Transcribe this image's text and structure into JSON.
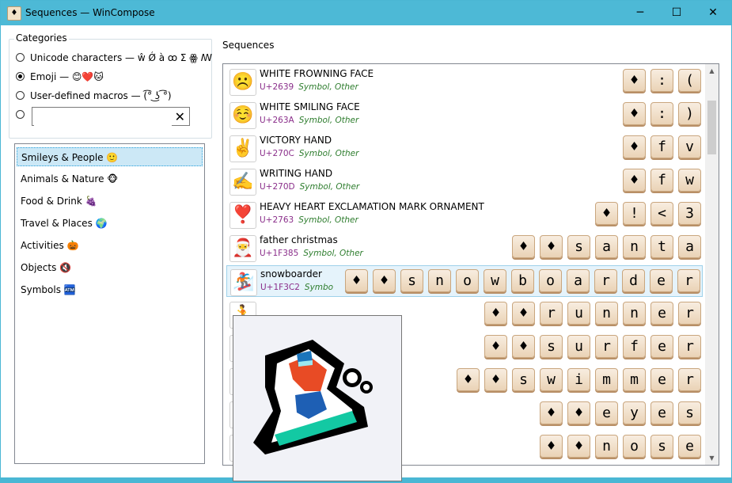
{
  "window": {
    "title": "Sequences — WinCompose",
    "app_icon": "♦",
    "minimize": "─",
    "maximize": "☐",
    "close": "✕"
  },
  "categories": {
    "legend": "Categories",
    "options": [
      {
        "label": "Unicode characters — ŵ Ǿ à ꝏ Σ ꙮ ꟿ",
        "selected": false
      },
      {
        "label": "Emoji — 😊❤️🐱",
        "selected": true
      },
      {
        "label": "User-defined macros — (͡° ͜ʖ ͡°)",
        "selected": false
      }
    ],
    "custom_value": "",
    "clear_label": "✕"
  },
  "emoji_categories": [
    {
      "label": "Smileys & People",
      "icon": "🙂",
      "selected": true
    },
    {
      "label": "Animals & Nature",
      "icon": "🐵",
      "selected": false
    },
    {
      "label": "Food & Drink",
      "icon": "🍇",
      "selected": false
    },
    {
      "label": "Travel & Places",
      "icon": "🌍",
      "selected": false
    },
    {
      "label": "Activities",
      "icon": "🎃",
      "selected": false
    },
    {
      "label": "Objects",
      "icon": "🔇",
      "selected": false
    },
    {
      "label": "Symbols",
      "icon": "🏧",
      "selected": false
    }
  ],
  "sequences": {
    "label": "Sequences",
    "rows": [
      {
        "glyph": "☹️",
        "name": "WHITE FROWNING FACE",
        "code": "U+2639",
        "category": "Symbol, Other",
        "keys": [
          "♦",
          ":",
          "("
        ]
      },
      {
        "glyph": "☺️",
        "name": "WHITE SMILING FACE",
        "code": "U+263A",
        "category": "Symbol, Other",
        "keys": [
          "♦",
          ":",
          ")"
        ]
      },
      {
        "glyph": "✌️",
        "name": "VICTORY HAND",
        "code": "U+270C",
        "category": "Symbol, Other",
        "keys": [
          "♦",
          "f",
          "v"
        ]
      },
      {
        "glyph": "✍️",
        "name": "WRITING HAND",
        "code": "U+270D",
        "category": "Symbol, Other",
        "keys": [
          "♦",
          "f",
          "w"
        ]
      },
      {
        "glyph": "❣️",
        "name": "HEAVY HEART EXCLAMATION MARK ORNAMENT",
        "code": "U+2763",
        "category": "Symbol, Other",
        "keys": [
          "♦",
          "!",
          "<",
          "3"
        ]
      },
      {
        "glyph": "🎅",
        "name": "father christmas",
        "code": "U+1F385",
        "category": "Symbol, Other",
        "keys": [
          "♦",
          "♦",
          "s",
          "a",
          "n",
          "t",
          "a"
        ]
      },
      {
        "glyph": "🏂",
        "name": "snowboarder",
        "code": "U+1F3C2",
        "category": "Symbo",
        "keys": [
          "♦",
          "♦",
          "s",
          "n",
          "o",
          "w",
          "b",
          "o",
          "a",
          "r",
          "d",
          "e",
          "r"
        ],
        "selected": true
      },
      {
        "glyph": "🏃",
        "name": "",
        "code": "",
        "category": "",
        "keys": [
          "♦",
          "♦",
          "r",
          "u",
          "n",
          "n",
          "e",
          "r"
        ]
      },
      {
        "glyph": "🏄",
        "name": "",
        "code": "",
        "category": "",
        "keys": [
          "♦",
          "♦",
          "s",
          "u",
          "r",
          "f",
          "e",
          "r"
        ]
      },
      {
        "glyph": "🏊",
        "name": "",
        "code": "",
        "category": "",
        "keys": [
          "♦",
          "♦",
          "s",
          "w",
          "i",
          "m",
          "m",
          "e",
          "r"
        ]
      },
      {
        "glyph": "👀",
        "name": "",
        "code": "",
        "category": "",
        "keys": [
          "♦",
          "♦",
          "e",
          "y",
          "e",
          "s"
        ]
      },
      {
        "glyph": "👃",
        "name": "",
        "code": "",
        "category": "",
        "keys": [
          "♦",
          "♦",
          "n",
          "o",
          "s",
          "e"
        ]
      }
    ]
  },
  "scrollbar": {
    "up": "▲",
    "down": "▼"
  },
  "tooltip": {
    "glyph_icon": "snowboarder-icon"
  }
}
